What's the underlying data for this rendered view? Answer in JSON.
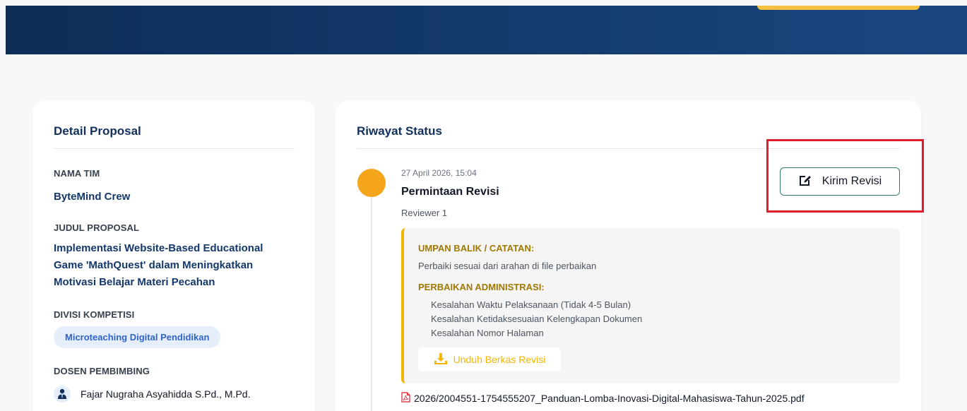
{
  "left": {
    "title": "Detail Proposal",
    "team_label": "NAMA TIM",
    "team_value": "ByteMind Crew",
    "proposal_label": "JUDUL PROPOSAL",
    "proposal_lines": [
      "Implementasi Website-Based Educational",
      "Game 'MathQuest' dalam Meningkatkan",
      "Motivasi Belajar Materi Pecahan"
    ],
    "division_label": "DIVISI KOMPETISI",
    "division_value": "Microteaching Digital Pendidikan",
    "advisor_label": "DOSEN PEMBIMBING",
    "advisor_name": "Fajar Nugraha Asyahidda S.Pd., M.Pd."
  },
  "right": {
    "title": "Riwayat Status",
    "entry": {
      "timestamp": "27 April 2026, 15:04",
      "status_title": "Permintaan Revisi",
      "reviewer": "Reviewer 1",
      "send_button": "Kirim Revisi",
      "feedback_heading": "UMPAN BALIK / CATATAN:",
      "feedback_text": "Perbaiki sesuai dari arahan di file perbaikan",
      "admin_heading": "PERBAIKAN ADMINISTRASI:",
      "admin_items": [
        "Kesalahan Waktu Pelaksanaan (Tidak 4-5 Bulan)",
        "Kesalahan Ketidaksesuaian Kelengkapan Dokumen",
        "Kesalahan Nomor Halaman"
      ],
      "download_button": "Unduh Berkas Revisi",
      "attachment": "2026/2004551-1754555207_Panduan-Lomba-Inovasi-Digital-Mahasiswa-Tahun-2025.pdf"
    }
  },
  "colors": {
    "header_start": "#0d2d57",
    "header_end": "#1a4780",
    "accent_orange": "#f4a51c",
    "accent_yellow": "#f5b400",
    "highlight_red": "#e11d2a",
    "title_navy": "#12305c"
  },
  "icons": {
    "edit": "edit-icon",
    "download": "download-icon",
    "pdf": "pdf-file-icon",
    "user": "user-tie-icon"
  }
}
